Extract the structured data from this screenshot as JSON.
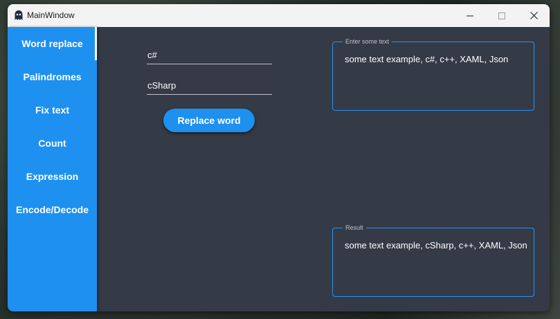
{
  "window": {
    "title": "MainWindow"
  },
  "titlebar": {
    "minimize_glyph": "─",
    "maximize_glyph": "☐",
    "close_glyph": "✕"
  },
  "sidebar": {
    "items": [
      {
        "label": "Word replace",
        "active": true
      },
      {
        "label": "Palindromes",
        "active": false
      },
      {
        "label": "Fix text",
        "active": false
      },
      {
        "label": "Count",
        "active": false
      },
      {
        "label": "Expression",
        "active": false
      },
      {
        "label": "Encode/Decode",
        "active": false
      }
    ]
  },
  "main": {
    "find_field": {
      "value": "c#"
    },
    "replace_field": {
      "value": "cSharp"
    },
    "replace_button": {
      "label": "Replace word"
    },
    "input_box": {
      "label": "Enter some text",
      "value": "some text example, c#, c++, XAML, Json"
    },
    "result_box": {
      "label": "Result",
      "value": "some text example, cSharp, c++, XAML, Json"
    }
  },
  "colors": {
    "accent": "#1e90f0",
    "background": "#353a47",
    "outline": "#2b93f0"
  }
}
